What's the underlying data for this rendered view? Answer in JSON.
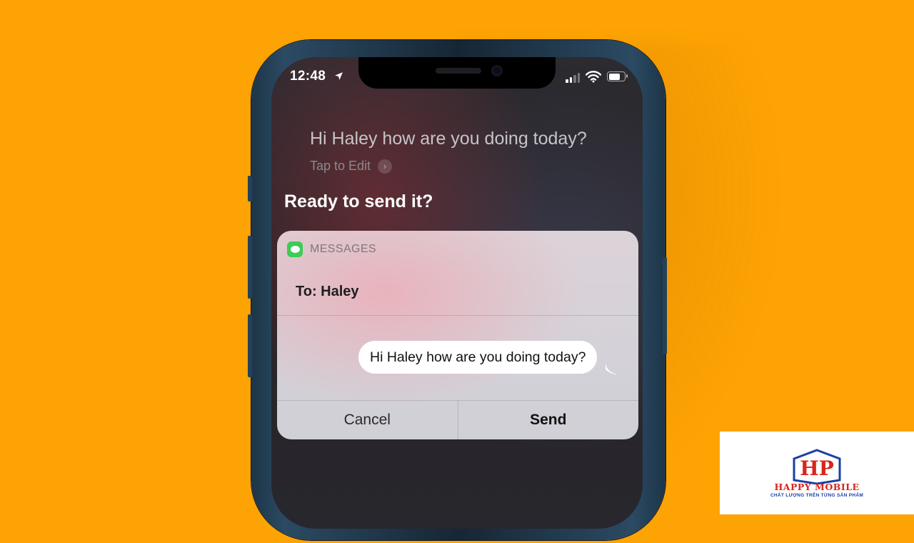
{
  "status_bar": {
    "time": "12:48",
    "icons": [
      "location-arrow-icon",
      "cellular-signal-icon",
      "wifi-icon",
      "battery-icon"
    ],
    "battery_level": 0.85
  },
  "siri": {
    "transcript": "Hi Haley how are you doing today?",
    "tap_to_edit": "Tap to Edit",
    "prompt": "Ready to send it?"
  },
  "message_card": {
    "app_label": "MESSAGES",
    "app_icon": "messages-app-icon",
    "to_line": "To: Haley",
    "message_text": "Hi Haley how are you doing today?",
    "cancel_label": "Cancel",
    "send_label": "Send"
  },
  "watermark": {
    "brand": "HAPPY MOBILE",
    "tagline": "CHẤT LƯỢNG TRÊN TỪNG SẢN PHẨM",
    "logo_letters": "HP"
  },
  "colors": {
    "background": "#FDA304",
    "messages_green": "#3ECB56",
    "brand_red": "#D7261E",
    "brand_blue": "#1A3FA6"
  }
}
